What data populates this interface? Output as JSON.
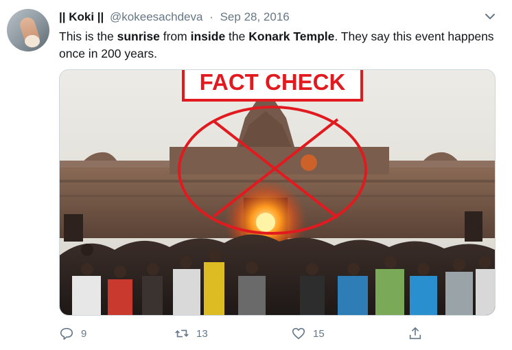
{
  "tweet": {
    "display_name": "|| Koki ||",
    "handle": "@kokeesachdeva",
    "separator": "·",
    "date": "Sep 28, 2016",
    "text_parts": [
      {
        "t": "This is the ",
        "b": false
      },
      {
        "t": "sunrise",
        "b": true
      },
      {
        "t": " from ",
        "b": false
      },
      {
        "t": "inside",
        "b": true
      },
      {
        "t": " the ",
        "b": false
      },
      {
        "t": "Konark Temple",
        "b": true
      },
      {
        "t": ". They say this event happens once in 200 years.",
        "b": false
      }
    ]
  },
  "media": {
    "overlay_label": "FACT CHECK",
    "overlay_color": "#e11a1f"
  },
  "actions": {
    "reply_count": "9",
    "retweet_count": "13",
    "like_count": "15"
  },
  "icons": {
    "caret": "chevron-down-icon",
    "reply": "reply-icon",
    "retweet": "retweet-icon",
    "like": "heart-icon",
    "share": "share-icon"
  },
  "colors": {
    "text": "#14171a",
    "secondary": "#657786",
    "border": "#ccd6dd"
  }
}
